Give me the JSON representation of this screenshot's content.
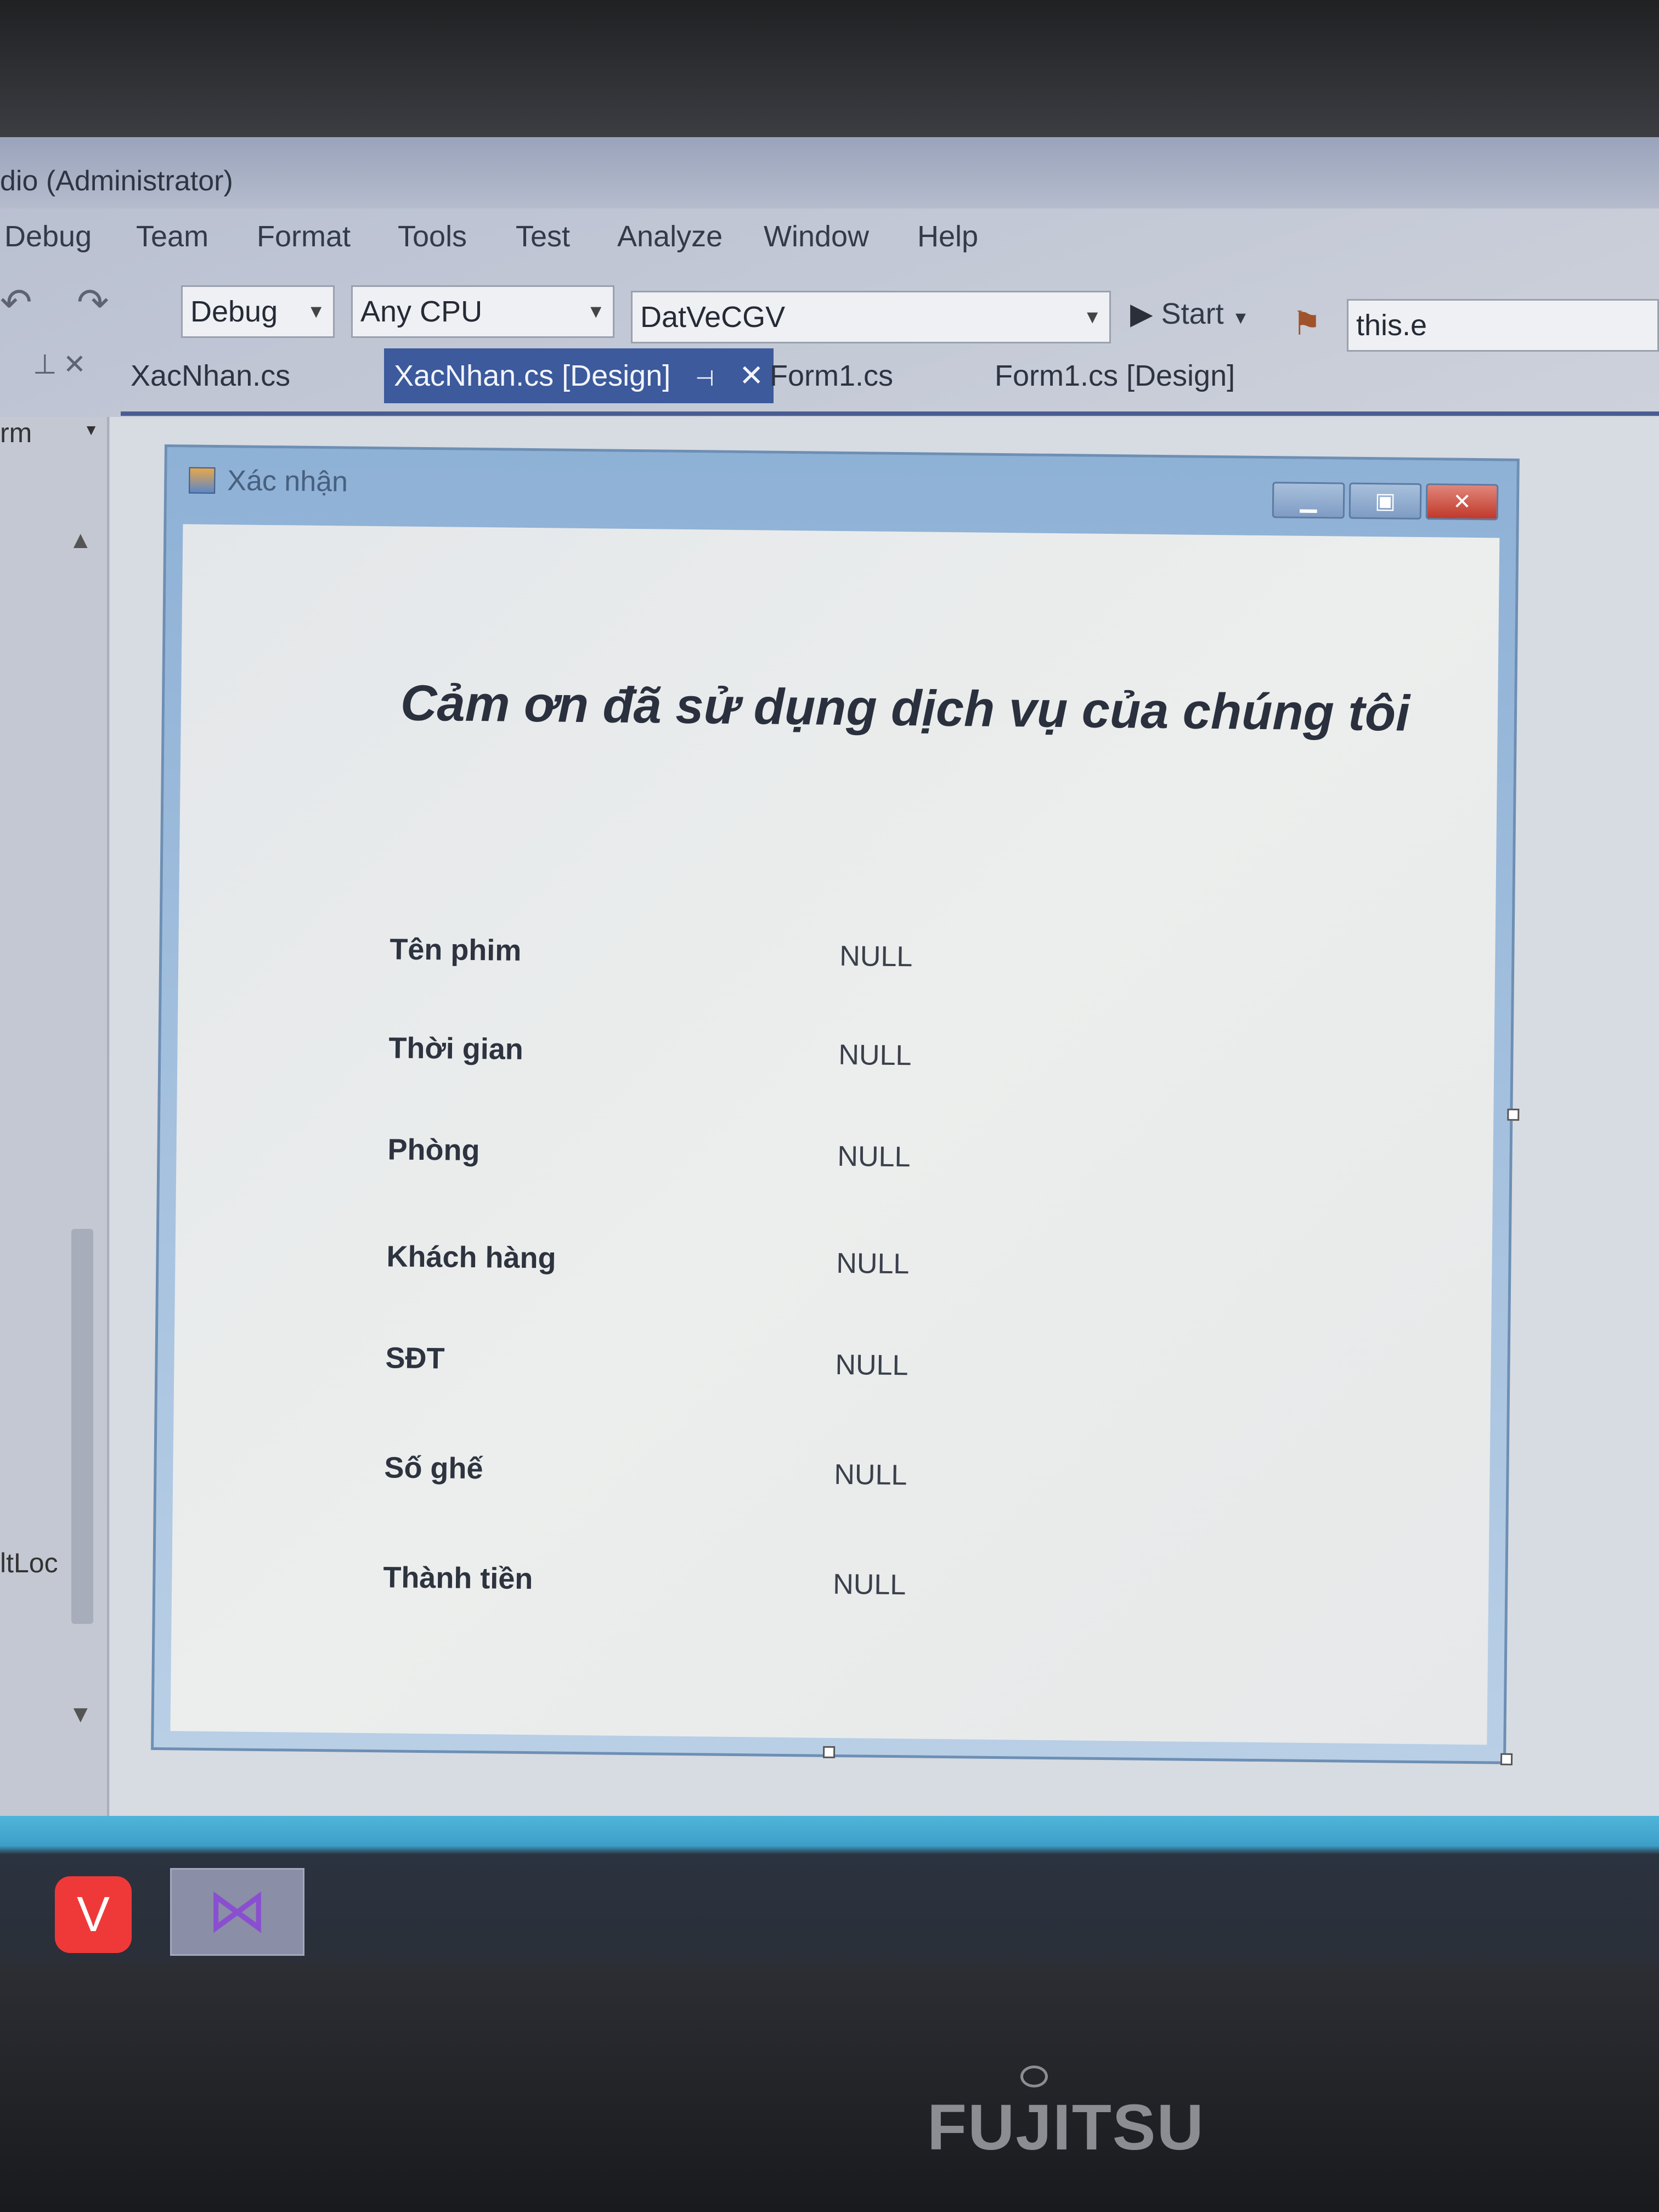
{
  "window": {
    "title": "dio (Administrator)"
  },
  "menu": [
    "Debug",
    "Team",
    "Format",
    "Tools",
    "Test",
    "Analyze",
    "Window",
    "Help"
  ],
  "toolbar": {
    "config": "Debug",
    "platform": "Any CPU",
    "project": "DatVeCGV",
    "start_label": "Start",
    "search_value": "this.e"
  },
  "tabs": [
    "XacNhan.cs",
    "XacNhan.cs [Design]",
    "Form1.cs",
    "Form1.cs [Design]"
  ],
  "left_panel": {
    "dropdown": "rm",
    "item": "ltLoc"
  },
  "form": {
    "title": "Xác nhận",
    "heading": "Cảm ơn đã sử dụng dịch vụ của chúng tôi",
    "fields": [
      {
        "label": "Tên phim",
        "value": "NULL"
      },
      {
        "label": "Thời gian",
        "value": "NULL"
      },
      {
        "label": "Phòng",
        "value": "NULL"
      },
      {
        "label": "Khách hàng",
        "value": "NULL"
      },
      {
        "label": "SĐT",
        "value": "NULL"
      },
      {
        "label": "Số ghế",
        "value": "NULL"
      },
      {
        "label": "Thành tiền",
        "value": "NULL"
      }
    ]
  },
  "taskbar": [
    "vivaldi-icon",
    "visual-studio-icon"
  ],
  "bezel": {
    "brand": "FUJITSU"
  },
  "colors": {
    "active_tab": "#3c5a9c",
    "close_button": "#c0392b",
    "taskbar_accent": "#3d9fc9"
  }
}
